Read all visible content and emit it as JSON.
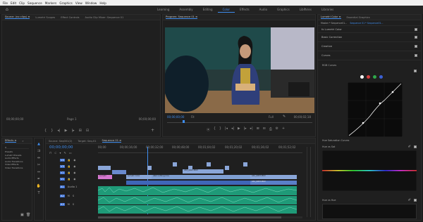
{
  "menu": [
    "File",
    "Edit",
    "Clip",
    "Sequence",
    "Markers",
    "Graphics",
    "View",
    "Window",
    "Help"
  ],
  "workspaces": {
    "items": [
      "Learning",
      "Assembly",
      "Editing",
      "Color",
      "Effects",
      "Audio",
      "Graphics",
      "Libraries",
      "Libraries"
    ],
    "active_index": 3,
    "more": "»"
  },
  "source_panel": {
    "tabs": [
      "Source: (no clips) ≡",
      "Lumetri Scopes",
      "Effect Controls",
      "Audio Clip Mixer: Sequence 01"
    ],
    "timecode_left": "00;00;00;00",
    "page": "Page 1",
    "timecode_right": "00;00;00;00"
  },
  "program": {
    "title": "Program: Sequence 01 ≡",
    "timecode": "00;00;00;00",
    "fit": "Fit",
    "quality": "Full",
    "duration": "00;00;02;18",
    "controls": [
      "⦿",
      "{",
      "}",
      "|◂",
      "◂|",
      "▶",
      "|▸",
      "▸|",
      "⊞",
      "⊟",
      "⎙",
      "⚙",
      "+"
    ]
  },
  "lumetri": {
    "tabs": [
      "Lumetri Color ≡",
      "Essential Graphics"
    ],
    "master": "Master * Sequence01...",
    "clip": "Sequence 01 * Sequence01...",
    "fx_label": "fx  Lumetri Color",
    "sections": [
      "Basic Correction",
      "Creative",
      "Curves"
    ],
    "rgb_curves": "RGB Curves",
    "hue_sat_curves": "Hue Saturation Curves",
    "hue_vs_sat": "Hue vs Sat",
    "hue_vs_hue": "Hue vs Hue",
    "curve_colors": [
      "#ffffff",
      "#d23b3b",
      "#2fa84a",
      "#3b5fd2"
    ]
  },
  "project": {
    "tabs": [
      "Effects ≡",
      "»"
    ],
    "items": [
      "Presets",
      "Lumetri Presets",
      "Audio Effects",
      "Audio Transitions",
      "Video Effects",
      "Video Transitions"
    ]
  },
  "timeline": {
    "tabs": [
      "Source: Seq001(2)",
      "Target: Seq-01",
      "Sequence 01 ≡"
    ],
    "timecode": "00;00;00;00",
    "ruler": [
      "00;00",
      "00;00;16;00",
      "00;00;32;00",
      "00;00;48;00",
      "00;01;04;02",
      "00;01;20;02",
      "00;01;36;02",
      "00;01;52;02"
    ],
    "video_tracks": [
      "V4",
      "V3",
      "V2",
      "V1"
    ],
    "audio_tracks": [
      "A1",
      "A2",
      "A3"
    ],
    "clip_labels": [
      "Lumetri",
      "Lumetri Color",
      "AS1_0003.MOV",
      "Alb2 nothing.mov",
      "AS1_0053.MOV",
      "AS1_0053.MOV"
    ],
    "audio_label": "Audio 1"
  }
}
